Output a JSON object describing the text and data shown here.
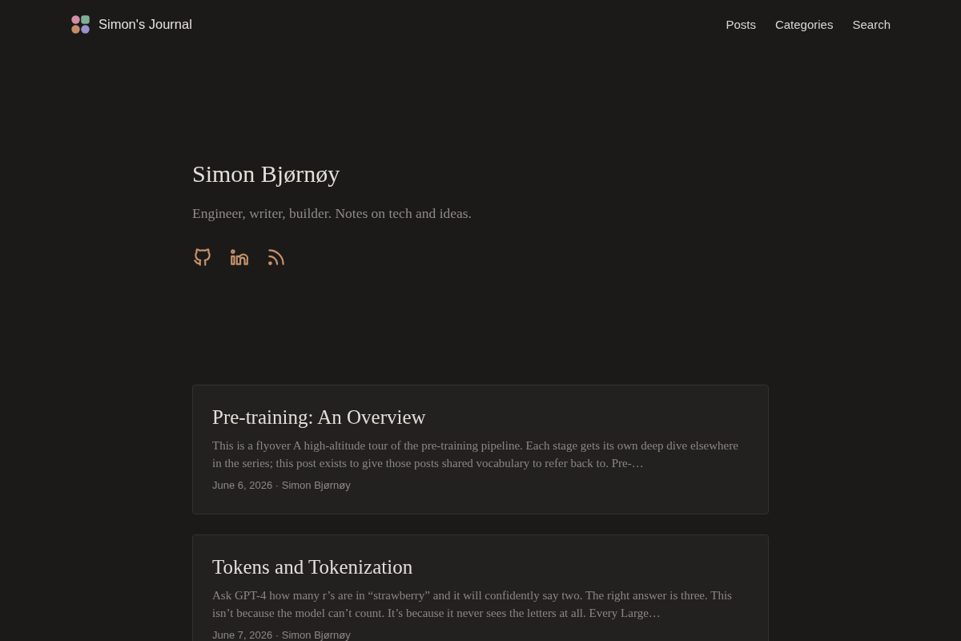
{
  "header": {
    "site_title": "Simon's Journal",
    "nav": [
      "Posts",
      "Categories",
      "Search"
    ]
  },
  "profile": {
    "name": "Simon Bjørnøy",
    "bio": "Engineer, writer, builder. Notes on tech and ideas.",
    "social_links": [
      {
        "kind": "github"
      },
      {
        "kind": "linkedin"
      },
      {
        "kind": "rss"
      }
    ]
  },
  "posts": [
    {
      "title": "Pre-training: An Overview",
      "excerpt": "This is a flyover A high-altitude tour of the pre-training pipeline. Each stage gets its own deep dive elsewhere in the series; this post exists to give those posts shared vocabulary to refer back to. Pre-…",
      "meta": "June 6, 2026 · Simon Bjørnøy"
    },
    {
      "title": "Tokens and Tokenization",
      "excerpt": "Ask GPT-4 how many r’s are in “strawberry” and it will confidently say two. The right answer is three. This isn’t because the model can’t count. It’s because it never sees the letters at all. Every Large…",
      "meta": "June 7, 2026 · Simon Bjørnøy"
    }
  ]
}
